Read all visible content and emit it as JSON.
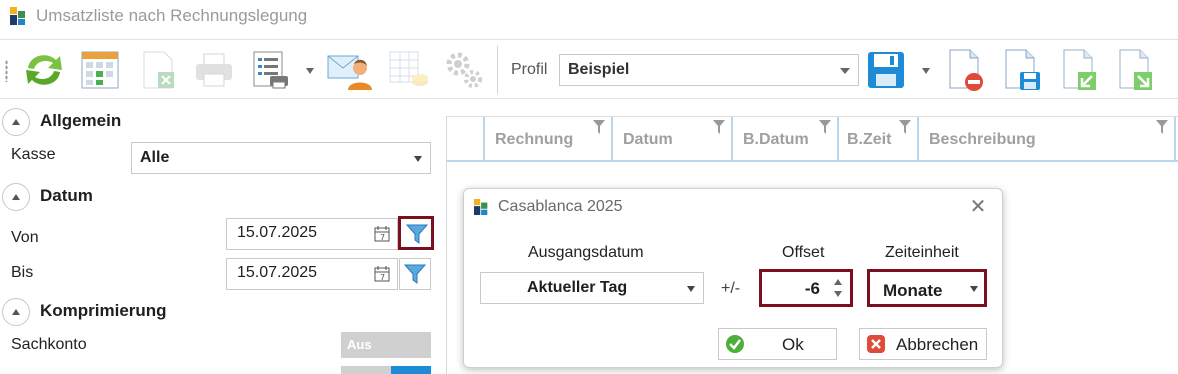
{
  "window": {
    "title": "Umsatzliste nach Rechnungslegung"
  },
  "toolbar": {
    "icons": [
      "refresh-icon",
      "grid-calendar-icon",
      "excel-export-icon",
      "print-icon",
      "print-list-icon",
      "email-contact-icon",
      "table-coins-icon",
      "settings-gears-icon",
      "save-icon",
      "delete-document-icon",
      "save-document-icon",
      "import-document-icon",
      "export-document-icon"
    ],
    "profil_label": "Profil",
    "profil_value": "Beispiel"
  },
  "sidebar": {
    "allgemein": {
      "title": "Allgemein",
      "kasse_label": "Kasse",
      "kasse_value": "Alle"
    },
    "datum": {
      "title": "Datum",
      "von_label": "Von",
      "von_value": "15.07.2025",
      "bis_label": "Bis",
      "bis_value": "15.07.2025"
    },
    "komprimierung": {
      "title": "Komprimierung",
      "sachkonto_label": "Sachkonto",
      "sachkonto_toggle": "Aus"
    }
  },
  "grid": {
    "columns": [
      "Rechnung",
      "Datum",
      "B.Datum",
      "B.Zeit",
      "Beschreibung"
    ]
  },
  "dialog": {
    "title": "Casablanca 2025",
    "ausgangsdatum_label": "Ausgangsdatum",
    "ausgangsdatum_value": "Aktueller Tag",
    "plusminus": "+/-",
    "offset_label": "Offset",
    "offset_value": "-6",
    "zeiteinheit_label": "Zeiteinheit",
    "zeiteinheit_value": "Monate",
    "ok_label": "Ok",
    "cancel_label": "Abbrechen"
  },
  "colors": {
    "highlight": "#7a0f1e",
    "grid_border": "#b8d6ee",
    "accent_blue": "#1e8bd6"
  }
}
